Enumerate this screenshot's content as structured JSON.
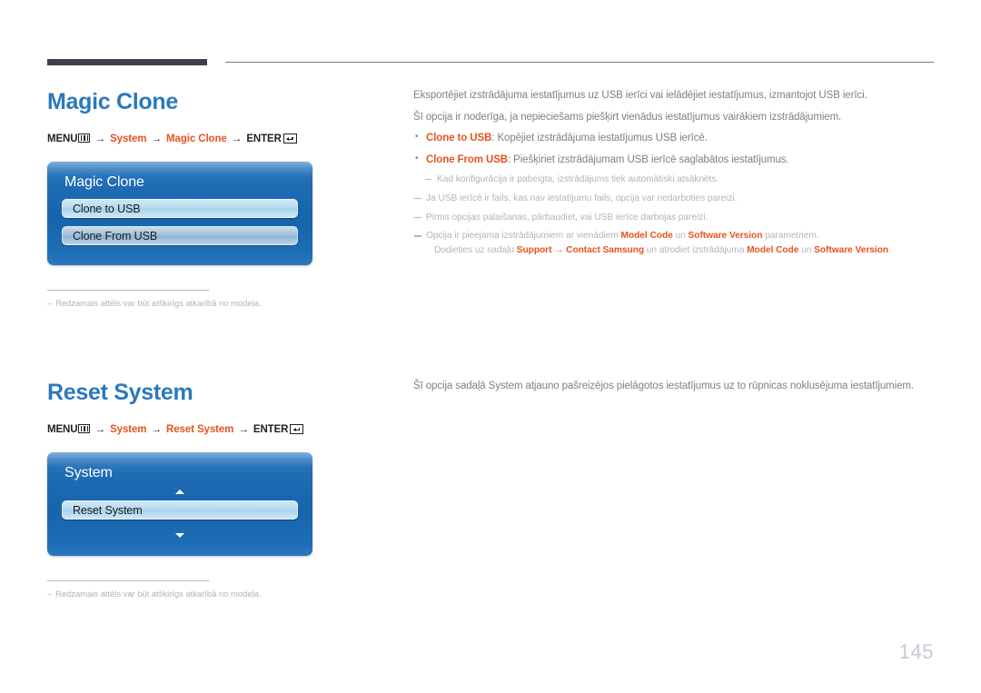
{
  "page": {
    "number": "145"
  },
  "sections": [
    {
      "id": "magic-clone",
      "title": "Magic Clone",
      "menupath": {
        "menu_label": "MENU",
        "menu_icon": "menu-icon",
        "arrow": "→",
        "step1": "System",
        "step2": "Magic Clone",
        "enter_label": "ENTER",
        "enter_icon": "enter-icon"
      },
      "osd": {
        "title": "Magic Clone",
        "rows": [
          {
            "label": "Clone to USB",
            "selected": true
          },
          {
            "label": "Clone From USB",
            "selected": false
          }
        ],
        "has_arrows": false
      },
      "footnote": {
        "dash": "–",
        "text": "Redzamais attēls var būt atšķirīgs atkarībā no modeļa."
      },
      "body": {
        "lead": [
          "Eksportējiet izstrādājuma iestatījumus uz USB ierīci vai ielādējiet iestatījumus, izmantojot USB ierīci.",
          "Šī opcija ir noderīga, ja nepieciešams piešķirt vienādus iestatījumus vairākiem izstrādājumiem."
        ],
        "bullets": [
          {
            "term": "Clone to USB",
            "rest": ": Kopējiet izstrādājuma iestatījumus USB ierīcē."
          },
          {
            "term": "Clone From USB",
            "rest": ": Piešķiriet izstrādājumam USB ierīcē saglabātos iestatījumus."
          }
        ],
        "subnotes": [
          {
            "level": 1,
            "text": "Kad konfigurācija ir pabeigta, izstrādājums tiek automātiski atsāknēts."
          }
        ],
        "notes": [
          {
            "text": "Ja USB ierīcē ir fails, kas nav iestatījumu fails, opcija var nedarboties pareizi."
          },
          {
            "text": "Pirms opcijas palaišanas, pārbaudiet, vai USB ierīce darbojas pareizi."
          }
        ],
        "note_rich": {
          "l1_a": "Opcija ir pieejama izstrādājumiem ar vienādiem ",
          "l1_b1": "Model Code",
          "l1_c": " un ",
          "l1_b2": "Software Version",
          "l1_d": " parametriem.",
          "l2_a": "Dodieties uz sadaļu ",
          "l2_b1": "Support",
          "l2_arrow": " → ",
          "l2_b2": "Contact Samsung",
          "l2_c": " un atrodiet izstrādājuma ",
          "l2_b3": "Model Code",
          "l2_d": " un ",
          "l2_b4": "Software Version",
          "l2_e": "."
        }
      }
    },
    {
      "id": "reset-system",
      "title": "Reset System",
      "menupath": {
        "menu_label": "MENU",
        "menu_icon": "menu-icon",
        "arrow": "→",
        "step1": "System",
        "step2": "Reset System",
        "enter_label": "ENTER",
        "enter_icon": "enter-icon"
      },
      "osd": {
        "title": "System",
        "rows": [
          {
            "label": "Reset System",
            "selected": true
          }
        ],
        "has_arrows": true
      },
      "footnote": {
        "dash": "–",
        "text": "Redzamais attēls var būt atšķirīgs atkarībā no modeļa."
      },
      "body": {
        "lead": [
          "Šī opcija sadaļā System atjauno pašreizējos pielāgotos iestatījumus uz to rūpnicas noklusējuma iestatījumiem."
        ]
      }
    }
  ],
  "colors": {
    "heading_blue": "#2b79bd",
    "accent_orange": "#e8531f",
    "body_grey": "#808085",
    "note_grey": "#b4b4b9",
    "header_bar": "#413e4c",
    "osd_blue": "#1764ad"
  }
}
